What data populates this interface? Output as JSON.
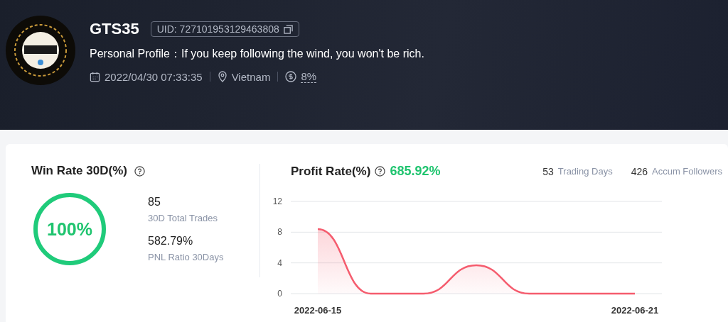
{
  "profile": {
    "name": "GTS35",
    "uid": "UID: 727101953129463808",
    "bio": "Personal Profile：If you keep following the wind, you won't be rich.",
    "joined": "2022/04/30 07:33:35",
    "location": "Vietnam",
    "share": "8%"
  },
  "win_rate": {
    "title": "Win Rate 30D(%)",
    "value": "100%",
    "level": 1,
    "stats": [
      {
        "value": "85",
        "label": "30D Total Trades"
      },
      {
        "value": "582.79%",
        "label": "PNL Ratio 30Days"
      }
    ]
  },
  "profit": {
    "title": "Profit Rate(%)",
    "value": "685.92%",
    "stats": [
      {
        "value": "53",
        "label": "Trading Days"
      },
      {
        "value": "426",
        "label": "Accum Followers"
      }
    ],
    "chart_data": {
      "type": "area",
      "categories": [
        "2022-06-15",
        null,
        null,
        null,
        null,
        null,
        "2022-06-21"
      ],
      "series": [
        {
          "color": "#f55c6e",
          "values": [
            8.4,
            0,
            0,
            3.7,
            0,
            0,
            0
          ]
        }
      ],
      "ylim": [
        0,
        12
      ],
      "yticks": [
        0,
        4,
        8,
        12
      ]
    }
  }
}
